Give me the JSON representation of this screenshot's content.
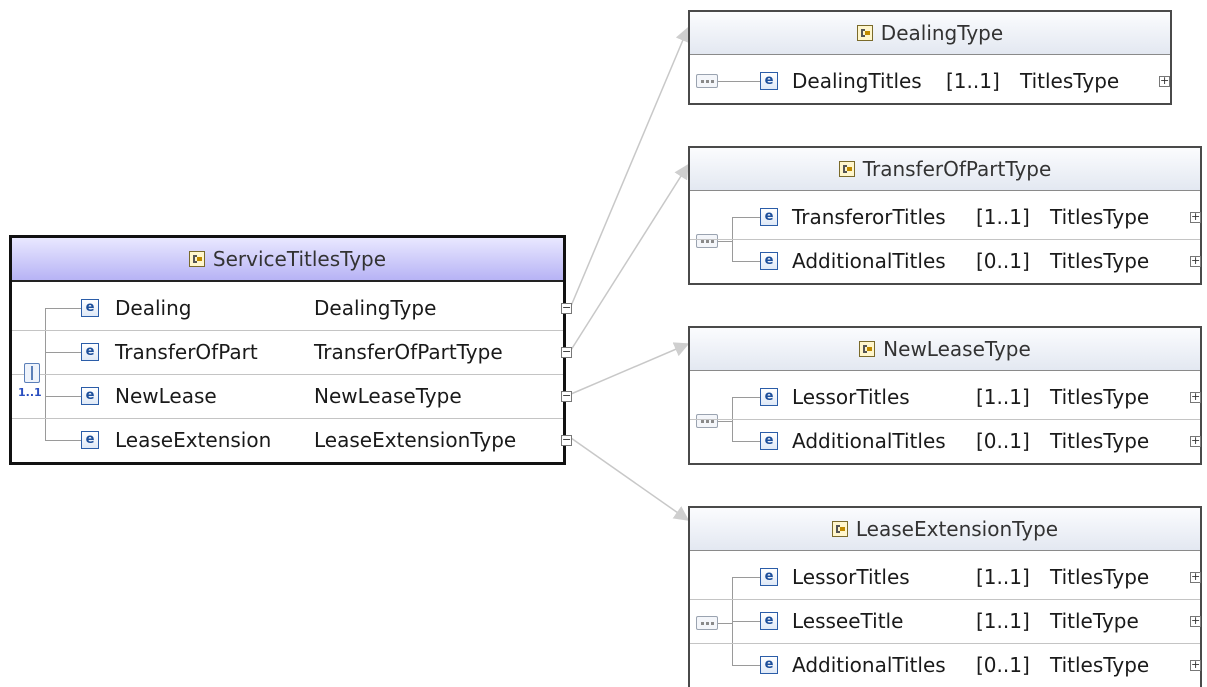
{
  "main": {
    "title": "ServiceTitlesType",
    "cardinality": "1..1",
    "elements": [
      {
        "name": "Dealing",
        "type": "DealingType"
      },
      {
        "name": "TransferOfPart",
        "type": "TransferOfPartType"
      },
      {
        "name": "NewLease",
        "type": "NewLeaseType"
      },
      {
        "name": "LeaseExtension",
        "type": "LeaseExtensionType"
      }
    ]
  },
  "types": {
    "dealing": {
      "title": "DealingType",
      "elements": [
        {
          "name": "DealingTitles",
          "card": "[1..1]",
          "type": "TitlesType"
        }
      ]
    },
    "transfer": {
      "title": "TransferOfPartType",
      "elements": [
        {
          "name": "TransferorTitles",
          "card": "[1..1]",
          "type": "TitlesType"
        },
        {
          "name": "AdditionalTitles",
          "card": "[0..1]",
          "type": "TitlesType"
        }
      ]
    },
    "newlease": {
      "title": "NewLeaseType",
      "elements": [
        {
          "name": "LessorTitles",
          "card": "[1..1]",
          "type": "TitlesType"
        },
        {
          "name": "AdditionalTitles",
          "card": "[0..1]",
          "type": "TitlesType"
        }
      ]
    },
    "leaseext": {
      "title": "LeaseExtensionType",
      "elements": [
        {
          "name": "LessorTitles",
          "card": "[1..1]",
          "type": "TitlesType"
        },
        {
          "name": "LesseeTitle",
          "card": "[1..1]",
          "type": "TitleType"
        },
        {
          "name": "AdditionalTitles",
          "card": "[0..1]",
          "type": "TitlesType"
        }
      ]
    }
  },
  "icons": {
    "element": "e",
    "expand": "+",
    "collapse": "−"
  }
}
